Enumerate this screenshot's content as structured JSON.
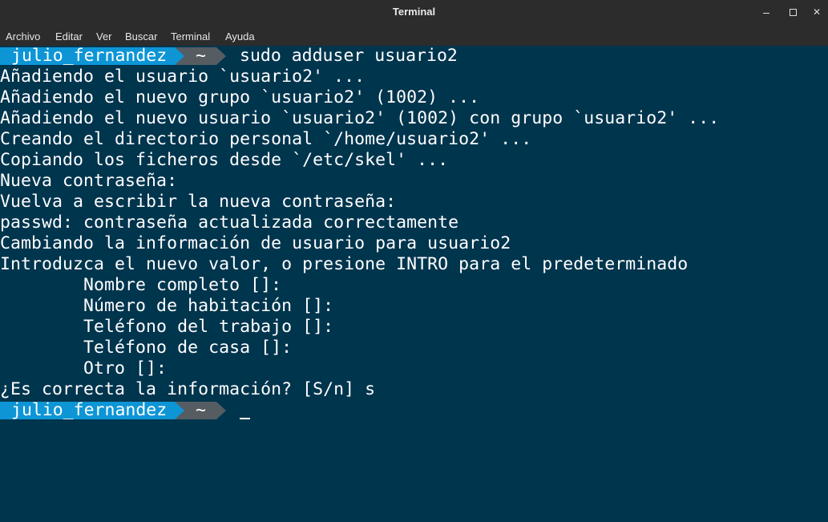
{
  "window": {
    "title": "Terminal",
    "minimize_label": "",
    "maximize_label": "",
    "close_label": "✕"
  },
  "menu": {
    "items": [
      "Archivo",
      "Editar",
      "Ver",
      "Buscar",
      "Terminal",
      "Ayuda"
    ]
  },
  "prompt": {
    "user": "julio_fernandez",
    "dir": "~",
    "command": "sudo adduser usuario2",
    "user_bg": "#0d95d6",
    "dir_bg": "#555d63"
  },
  "output": [
    "Añadiendo el usuario `usuario2' ...",
    "Añadiendo el nuevo grupo `usuario2' (1002) ...",
    "Añadiendo el nuevo usuario `usuario2' (1002) con grupo `usuario2' ...",
    "Creando el directorio personal `/home/usuario2' ...",
    "Copiando los ficheros desde `/etc/skel' ...",
    "Nueva contraseña:",
    "Vuelva a escribir la nueva contraseña:",
    "passwd: contraseña actualizada correctamente",
    "Cambiando la información de usuario para usuario2",
    "Introduzca el nuevo valor, o presione INTRO para el predeterminado",
    "        Nombre completo []:",
    "        Número de habitación []:",
    "        Teléfono del trabajo []:",
    "        Teléfono de casa []:",
    "        Otro []:",
    "¿Es correcta la información? [S/n] s"
  ],
  "prompt2": {
    "user": "julio_fernandez",
    "dir": "~",
    "command": ""
  },
  "colors": {
    "terminal_bg": "#00354e",
    "titlebar_bg": "#2c2c2c",
    "text": "#ffffff"
  }
}
